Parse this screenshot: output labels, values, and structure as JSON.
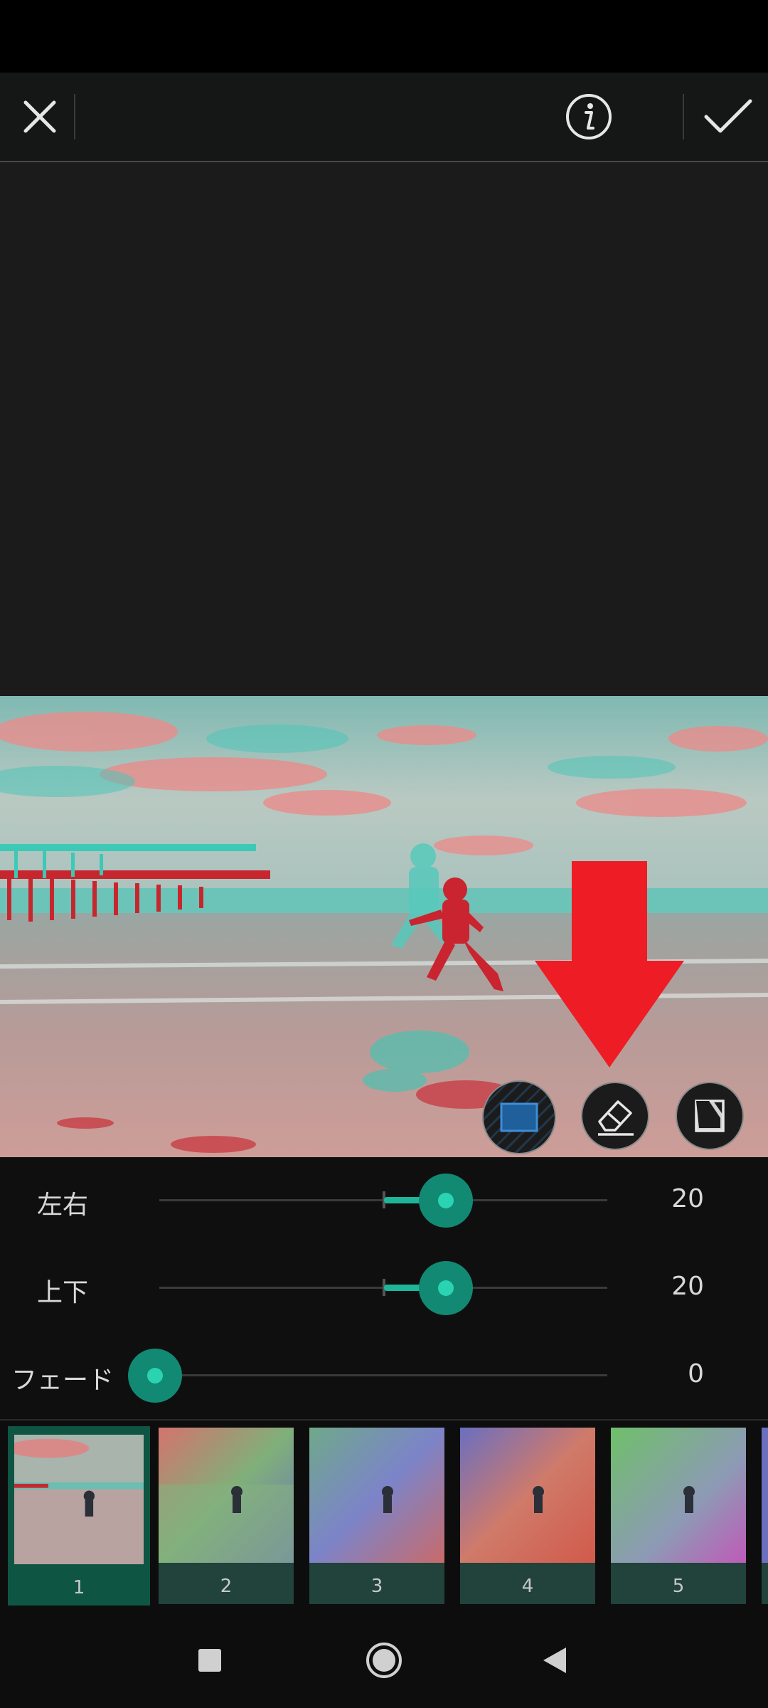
{
  "toolbar": {
    "close_icon": "close-icon",
    "info_icon": "info-icon",
    "confirm_icon": "checkmark-icon"
  },
  "tools": [
    {
      "name": "rectangle-mask-icon",
      "active": true
    },
    {
      "name": "eraser-icon",
      "active": false
    },
    {
      "name": "invert-mask-icon",
      "active": false
    }
  ],
  "sliders": {
    "horizontal": {
      "label": "左右",
      "value": "20"
    },
    "vertical": {
      "label": "上下",
      "value": "20"
    },
    "fade": {
      "label": "フェード",
      "value": "0"
    }
  },
  "filters": [
    {
      "label": "1",
      "selected": true
    },
    {
      "label": "2",
      "selected": false
    },
    {
      "label": "3",
      "selected": false
    },
    {
      "label": "4",
      "selected": false
    },
    {
      "label": "5",
      "selected": false
    }
  ],
  "colors": {
    "accent": "#1fb59a",
    "annotation_arrow": "#ee1c25"
  },
  "navbar": {
    "recents_icon": "square-icon",
    "home_icon": "circle-icon",
    "back_icon": "triangle-back-icon"
  }
}
